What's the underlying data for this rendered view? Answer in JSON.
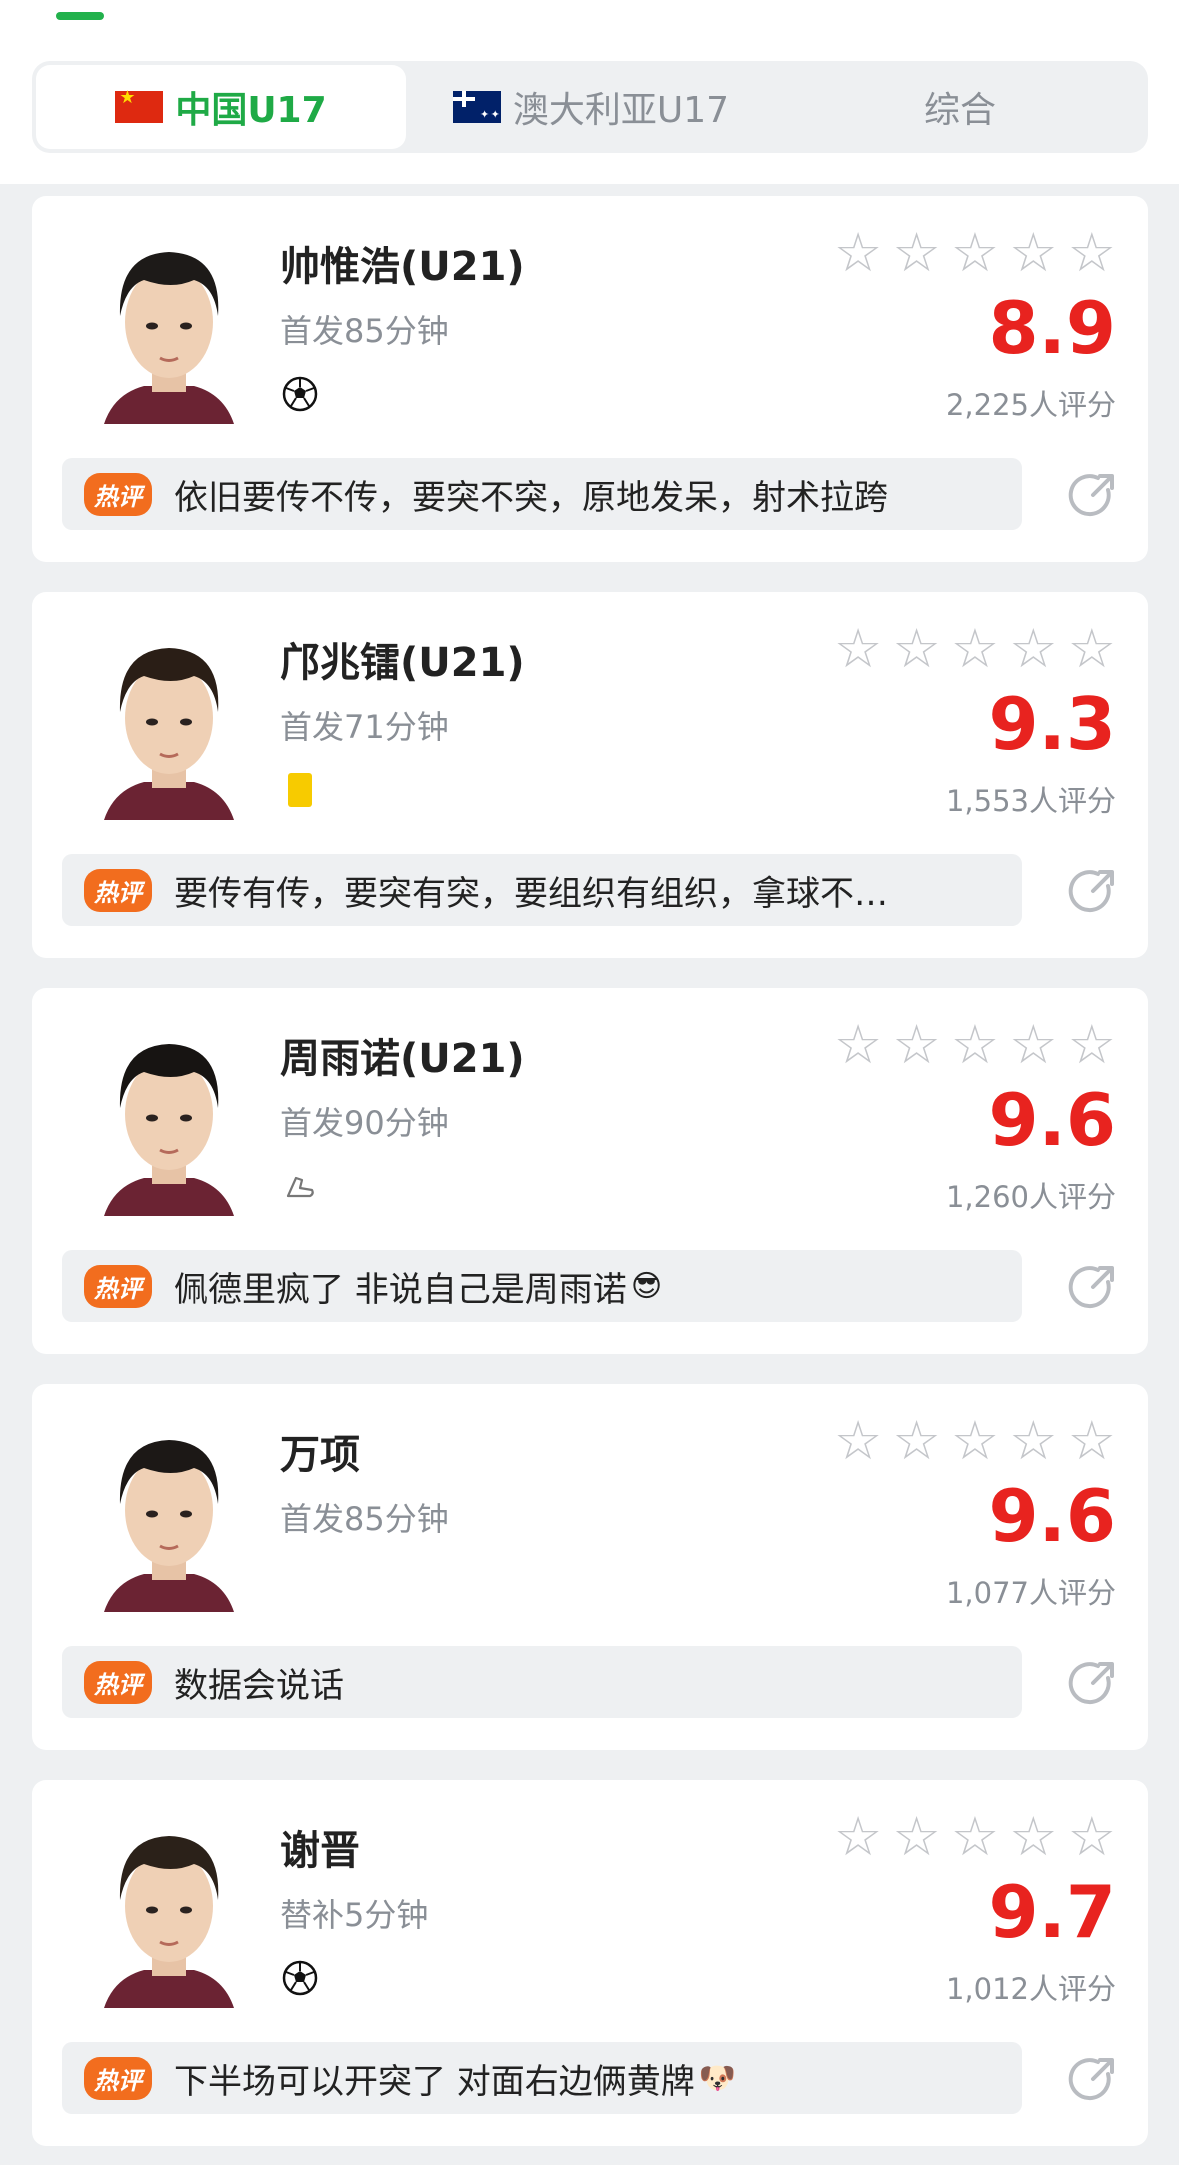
{
  "tabs": [
    {
      "label": "中国U17",
      "flag": "china-flag",
      "active": true
    },
    {
      "label": "澳大利亚U17",
      "flag": "australia-flag",
      "active": false
    },
    {
      "label": "综合",
      "active": false
    }
  ],
  "colors": {
    "accent_green": "#1faa46",
    "score_red": "#e8231f",
    "hot_orange": "#f26d1e"
  },
  "players": [
    {
      "name": "帅惟浩(U21)",
      "minutes": "首发85分钟",
      "event_icon": "soccer-ball-icon",
      "score": "8.9",
      "count": "2,225人评分",
      "hot_label": "热评",
      "comment": "依旧要传不传，要突不突，原地发呆，射术拉跨",
      "emoji": ""
    },
    {
      "name": "邝兆镭(U21)",
      "minutes": "首发71分钟",
      "event_icon": "yellow-card-icon",
      "score": "9.3",
      "count": "1,553人评分",
      "hot_label": "热评",
      "comment": "要传有传，要突有突，要组织有组织，拿球不…",
      "emoji": ""
    },
    {
      "name": "周雨诺(U21)",
      "minutes": "首发90分钟",
      "event_icon": "boot-icon",
      "score": "9.6",
      "count": "1,260人评分",
      "hot_label": "热评",
      "comment": "佩德里疯了 非说自己是周雨诺",
      "emoji": "😎"
    },
    {
      "name": "万项",
      "minutes": "首发85分钟",
      "event_icon": "",
      "score": "9.6",
      "count": "1,077人评分",
      "hot_label": "热评",
      "comment": "数据会说话",
      "emoji": ""
    },
    {
      "name": "谢晋",
      "minutes": "替补5分钟",
      "event_icon": "soccer-ball-icon",
      "score": "9.7",
      "count": "1,012人评分",
      "hot_label": "热评",
      "comment": "下半场可以开突了 对面右边俩黄牌",
      "emoji": "🐶"
    }
  ]
}
